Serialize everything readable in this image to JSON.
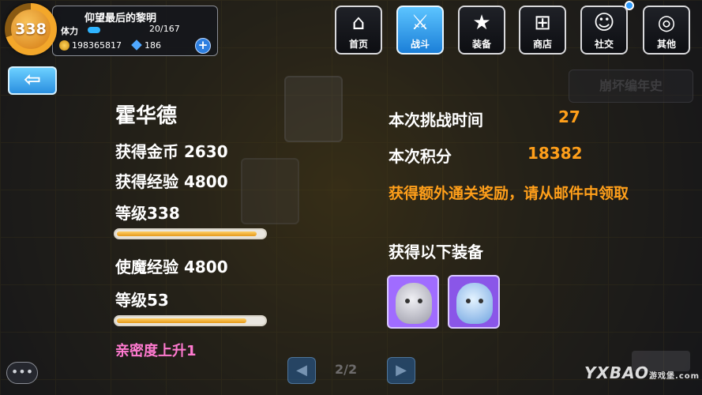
{
  "player": {
    "level": "338",
    "name": "仰望最后的黎明",
    "stamina_label": "体力",
    "stamina_value": "20/167",
    "coins": "198365817",
    "gems": "186",
    "add_label": "+"
  },
  "nav": [
    {
      "label": "首页",
      "icon": "home-icon",
      "glyph": "⌂"
    },
    {
      "label": "战斗",
      "icon": "battle-icon",
      "glyph": "⚔"
    },
    {
      "label": "装备",
      "icon": "equipment-icon",
      "glyph": "★"
    },
    {
      "label": "商店",
      "icon": "shop-icon",
      "glyph": "⊞"
    },
    {
      "label": "社交",
      "icon": "social-icon",
      "glyph": "☺"
    },
    {
      "label": "其他",
      "icon": "other-icon",
      "glyph": "◎"
    }
  ],
  "back_glyph": "⇦",
  "ghost": {
    "chronicle_label": "崩坏编年史"
  },
  "results": {
    "character_name": "霍华德",
    "coins_line": "获得金币 2630",
    "exp_line": "获得经验 4800",
    "level_line": "等级338",
    "level_progress": 0.95,
    "summon_exp_line": "使魔经验 4800",
    "summon_level_line": "等级53",
    "summon_level_progress": 0.88,
    "intimacy_line": "亲密度上升1",
    "time_label": "本次挑战时间",
    "time_value": "27",
    "score_label": "本次积分",
    "score_value": "18382",
    "mail_notice": "获得额外通关奖励，请从邮件中领取",
    "equipment_label": "获得以下装备"
  },
  "pagination": {
    "current": "2/2",
    "prev_glyph": "◀",
    "next_glyph": "▶"
  },
  "chat_glyph": "•••",
  "watermark": {
    "brand": "YXBAO",
    "sub": "游戏堡",
    "domain": ".com"
  },
  "colors": {
    "accent_orange": "#ff9f1a",
    "intimacy_pink": "#ff7ad0",
    "active_tab_blue": "#2a8fe0"
  }
}
